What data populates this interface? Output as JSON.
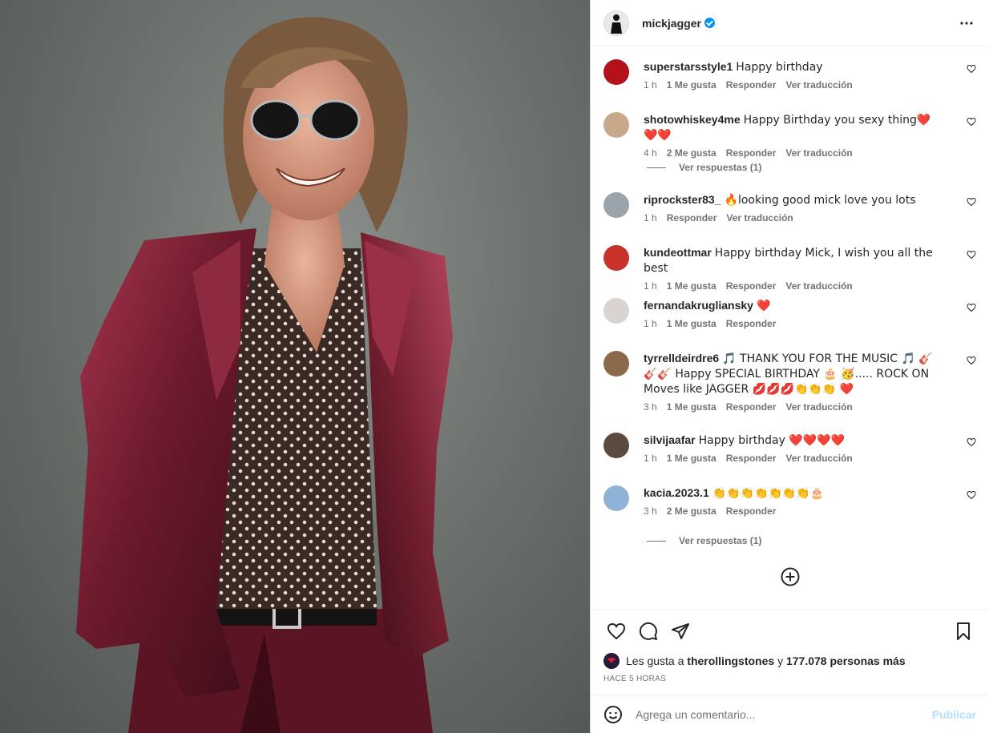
{
  "post": {
    "username": "mickjagger",
    "more_icon": "more-horizontal-icon",
    "photo_alt": "Portrait of a smiling man with aviator sunglasses, burgundy satin suit and polka-dot shirt"
  },
  "comments": [
    {
      "user": "superstarsstyle1",
      "text": "Happy birthday",
      "time": "1 h",
      "likes": "1 Me gusta",
      "reply": "Responder",
      "translate": "Ver traducción",
      "avatar_color": "#b3121a"
    },
    {
      "user": "shotowhiskey4me",
      "text": "Happy Birthday you sexy thing❤️❤️❤️",
      "time": "4 h",
      "likes": "2 Me gusta",
      "reply": "Responder",
      "translate": "Ver traducción",
      "avatar_color": "#c7a98a",
      "replies_label": "Ver respuestas (1)"
    },
    {
      "user": "riprockster83_",
      "text": "🔥looking good mick love you lots",
      "time": "1 h",
      "likes": "",
      "reply": "Responder",
      "translate": "Ver traducción",
      "avatar_color": "#9aa4aa"
    },
    {
      "user": "kundeottmar",
      "text": "Happy birthday Mick, I wish you all the best",
      "time": "1 h",
      "likes": "1 Me gusta",
      "reply": "Responder",
      "translate": "Ver traducción",
      "avatar_color": "#c8322a"
    },
    {
      "user": "fernandakrugliansky",
      "text": "❤️",
      "time": "1 h",
      "likes": "1 Me gusta",
      "reply": "Responder",
      "translate": "",
      "avatar_color": "#d9d4cf"
    },
    {
      "user": "tyrrelldeirdre6",
      "text": "🎵 THANK YOU FOR THE MUSIC 🎵 🎸🎸🎸 Happy SPECIAL BIRTHDAY 🎂 🥳..... ROCK ON Moves like JAGGER 💋💋💋👏👏👏 ❤️",
      "time": "3 h",
      "likes": "1 Me gusta",
      "reply": "Responder",
      "translate": "Ver traducción",
      "avatar_color": "#8a6a4a"
    },
    {
      "user": "silvijaafar",
      "text": "Happy birthday ❤️❤️❤️❤️",
      "time": "1 h",
      "likes": "1 Me gusta",
      "reply": "Responder",
      "translate": "Ver traducción",
      "avatar_color": "#5b4a3e"
    },
    {
      "user": "kacia.2023.1",
      "text": "👏👏👏👏👏👏👏🎂",
      "time": "3 h",
      "likes": "2 Me gusta",
      "reply": "Responder",
      "translate": "",
      "avatar_color": "#8fb3d6",
      "replies_label": "Ver respuestas (1)"
    }
  ],
  "likes": {
    "prefix": "Les gusta a",
    "user": "therollingstones",
    "mid": "y",
    "count": "177.078 personas más"
  },
  "timestamp": "HACE 5 HORAS",
  "composer": {
    "placeholder": "Agrega un comentario...",
    "publish": "Publicar"
  }
}
